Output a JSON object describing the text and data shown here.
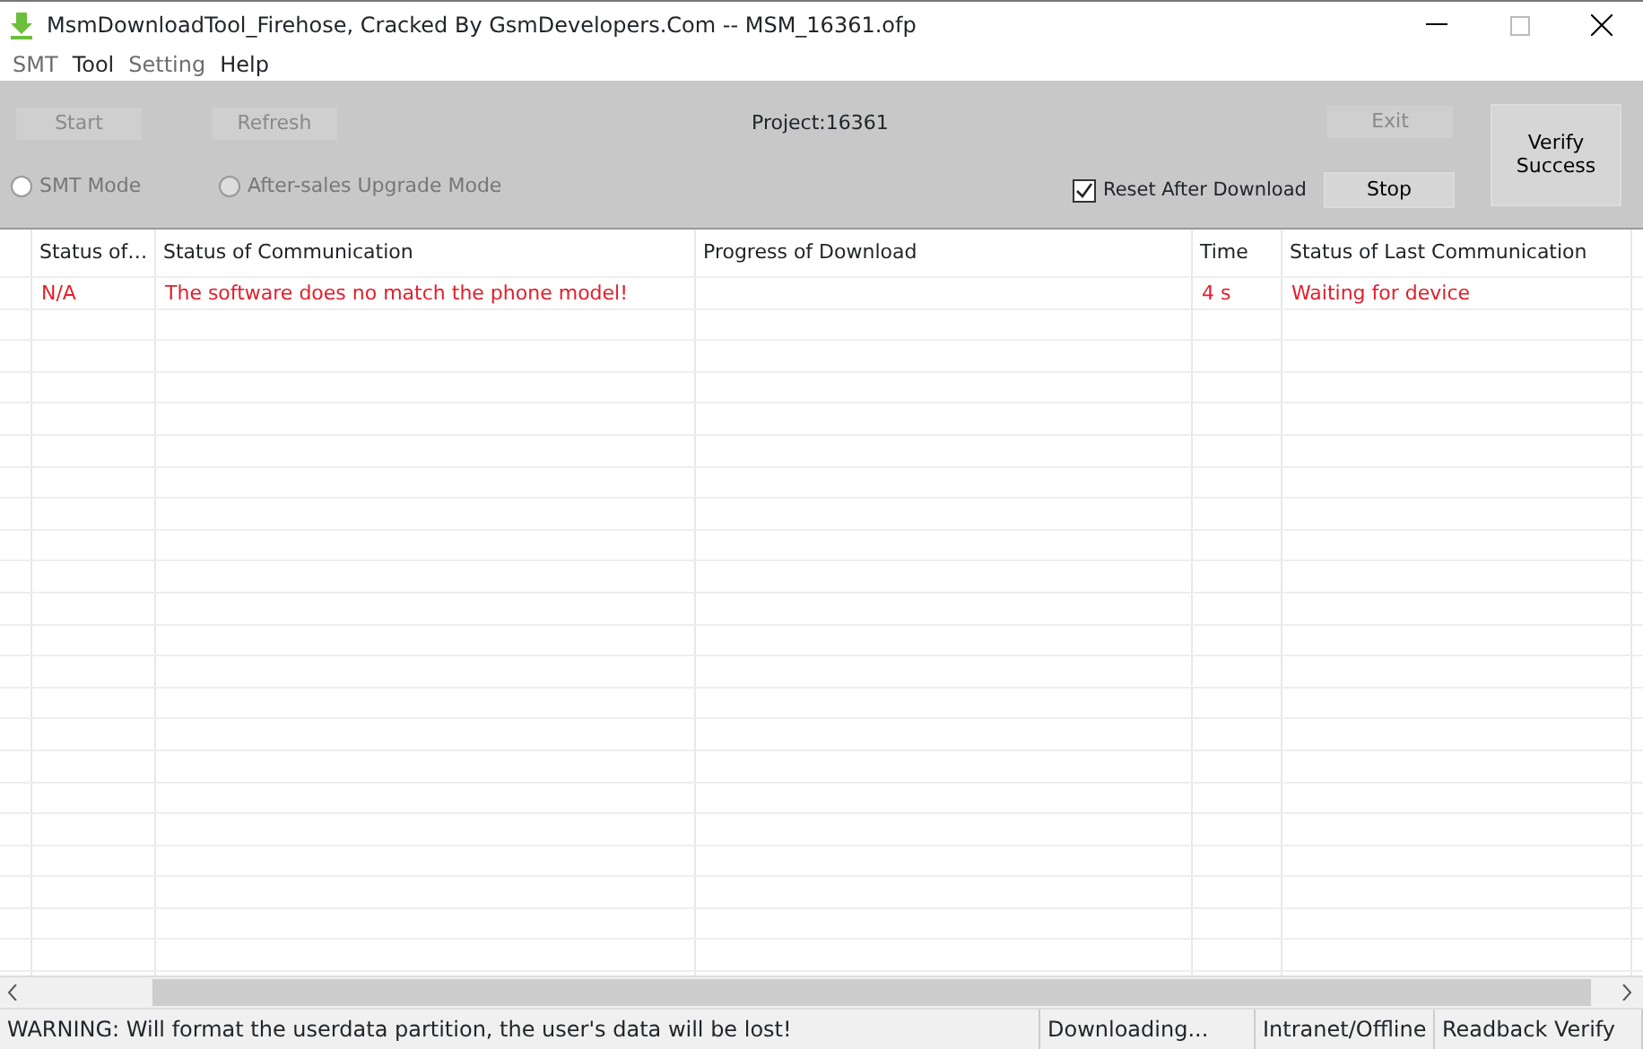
{
  "window": {
    "title": "MsmDownloadTool_Firehose, Cracked By GsmDevelopers.Com -- MSM_16361.ofp"
  },
  "menu": [
    {
      "label": "SMT",
      "disabled": true
    },
    {
      "label": "Tool",
      "disabled": false
    },
    {
      "label": "Setting",
      "disabled": true
    },
    {
      "label": "Help",
      "disabled": false
    }
  ],
  "toolbar": {
    "start": {
      "label": "Start",
      "disabled": true
    },
    "refresh": {
      "label": "Refresh",
      "disabled": true
    },
    "project": "Project:16361",
    "exit": {
      "label": "Exit",
      "disabled": true
    },
    "stop": {
      "label": "Stop",
      "disabled": false
    },
    "verify": {
      "label": "Verify Success",
      "disabled": false
    },
    "modes": [
      {
        "label": "SMT Mode",
        "selected": false,
        "disabled": false
      },
      {
        "label": "After-sales Upgrade Mode",
        "selected": false,
        "disabled": true
      }
    ],
    "reset_after_download": {
      "label": "Reset After Download",
      "checked": true
    }
  },
  "table": {
    "columns": [
      "Status of…",
      "Status of Communication",
      "Progress of Download",
      "Time",
      "Status of Last Communication"
    ],
    "rows": [
      {
        "error": true,
        "cells": [
          "N/A",
          "The software does no match the phone model!",
          "",
          "4 s",
          "Waiting for device"
        ]
      }
    ]
  },
  "status_bar": [
    "WARNING: Will format the userdata partition, the user's data will be lost!",
    "Downloading...",
    "Intranet/Offline",
    "Readback Verify"
  ]
}
